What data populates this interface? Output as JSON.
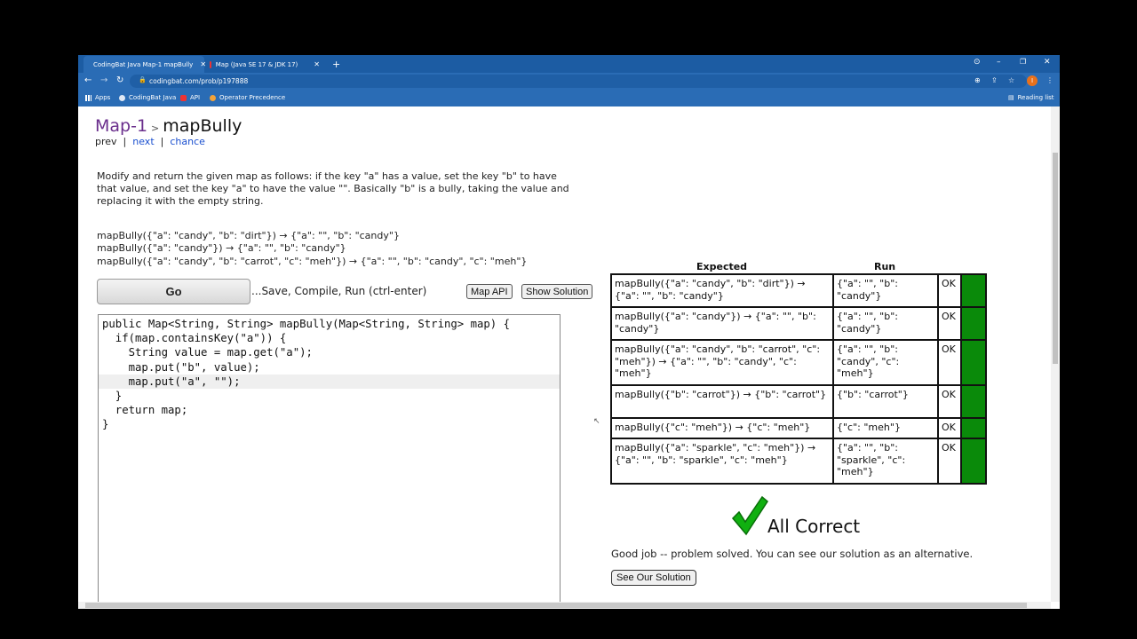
{
  "browser": {
    "tabs": [
      {
        "label": "CodingBat Java Map-1 mapBully",
        "active": true
      },
      {
        "label": "Map (Java SE 17 & JDK 17)",
        "active": false
      }
    ],
    "new_tab": "+",
    "url": "codingbat.com/prob/p197888",
    "bookmarks": [
      "Apps",
      "CodingBat Java",
      "API",
      "Operator Precedence"
    ],
    "reading_list": "Reading list",
    "avatar_letter": "I"
  },
  "page": {
    "section": "Map-1",
    "separator": ">",
    "problem": "mapBully",
    "nav": {
      "prev": "prev",
      "next": "next",
      "chance": "chance",
      "sep": "|"
    },
    "description": "Modify and return the given map as follows: if the key \"a\" has a value, set the key \"b\" to have that value, and set the key \"a\" to have the value \"\". Basically \"b\" is a bully, taking the value and replacing it with the empty string.",
    "examples": [
      "mapBully({\"a\": \"candy\", \"b\": \"dirt\"}) → {\"a\": \"\", \"b\": \"candy\"}",
      "mapBully({\"a\": \"candy\"}) → {\"a\": \"\", \"b\": \"candy\"}",
      "mapBully({\"a\": \"candy\", \"b\": \"carrot\", \"c\": \"meh\"}) → {\"a\": \"\", \"b\": \"candy\", \"c\": \"meh\"}"
    ],
    "go_label": "Go",
    "save_hint": "...Save, Compile, Run (ctrl-enter)",
    "map_api_label": "Map API",
    "show_solution_label": "Show Solution",
    "code_lines": [
      "public Map<String, String> mapBully(Map<String, String> map) {",
      "  if(map.containsKey(\"a\")) {",
      "    String value = map.get(\"a\");",
      "    map.put(\"b\", value);",
      "    map.put(\"a\", \"\");",
      "  }",
      "  return map;",
      "}"
    ],
    "results": {
      "header_expected": "Expected",
      "header_run": "Run",
      "rows": [
        {
          "expected": "mapBully({\"a\": \"candy\", \"b\": \"dirt\"}) → {\"a\": \"\", \"b\": \"candy\"}",
          "run": "{\"a\": \"\", \"b\": \"candy\"}",
          "status": "OK"
        },
        {
          "expected": "mapBully({\"a\": \"candy\"}) → {\"a\": \"\", \"b\": \"candy\"}",
          "run": "{\"a\": \"\", \"b\": \"candy\"}",
          "status": "OK"
        },
        {
          "expected": "mapBully({\"a\": \"candy\", \"b\": \"carrot\", \"c\": \"meh\"}) → {\"a\": \"\", \"b\": \"candy\", \"c\": \"meh\"}",
          "run": "{\"a\": \"\", \"b\": \"candy\", \"c\": \"meh\"}",
          "status": "OK"
        },
        {
          "expected": "mapBully({\"b\": \"carrot\"}) → {\"b\": \"carrot\"}",
          "run": "{\"b\": \"carrot\"}",
          "status": "OK"
        },
        {
          "expected": "mapBully({\"c\": \"meh\"}) → {\"c\": \"meh\"}",
          "run": "{\"c\": \"meh\"}",
          "status": "OK"
        },
        {
          "expected": "mapBully({\"a\": \"sparkle\", \"c\": \"meh\"}) → {\"a\": \"\", \"b\": \"sparkle\", \"c\": \"meh\"}",
          "run": "{\"a\": \"\", \"b\": \"sparkle\", \"c\": \"meh\"}",
          "status": "OK"
        }
      ],
      "pass_color": "#0a8a0a"
    },
    "all_correct": "All Correct",
    "good_job": "Good job -- problem solved. You can see our solution as an alternative.",
    "see_solution_label": "See Our Solution"
  },
  "colors": {
    "chrome_blue": "#2a6cb5",
    "check_green": "#10b010",
    "section_purple": "#6a2e8c"
  }
}
